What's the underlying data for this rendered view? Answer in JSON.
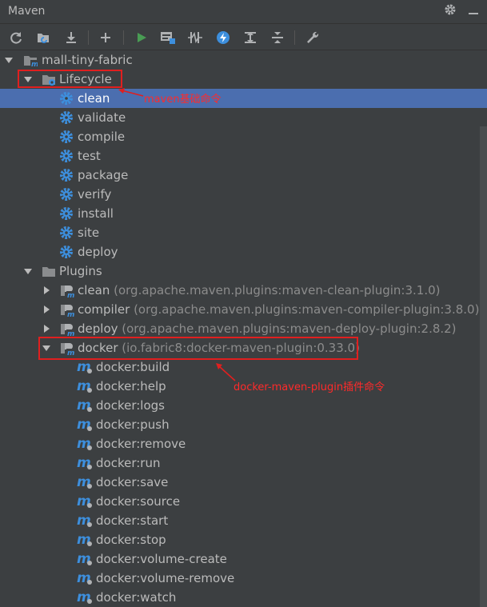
{
  "window": {
    "title": "Maven"
  },
  "toolbar": {
    "buttons": [
      {
        "name": "reimport-icon"
      },
      {
        "name": "generate-sources-icon"
      },
      {
        "name": "download-icon"
      },
      {
        "name": "add-icon"
      },
      {
        "name": "run-icon"
      },
      {
        "name": "execute-goal-icon"
      },
      {
        "name": "toggle-offline-icon"
      },
      {
        "name": "skip-tests-icon"
      },
      {
        "name": "show-dependencies-icon"
      },
      {
        "name": "collapse-all-icon"
      },
      {
        "name": "settings-wrench-icon"
      }
    ]
  },
  "tree": {
    "project": "mall-tiny-fabric",
    "lifecycle": {
      "label": "Lifecycle",
      "goals": [
        "clean",
        "validate",
        "compile",
        "test",
        "package",
        "verify",
        "install",
        "site",
        "deploy"
      ]
    },
    "plugins": {
      "label": "Plugins",
      "items": [
        {
          "name": "clean",
          "detail": "(org.apache.maven.plugins:maven-clean-plugin:3.1.0)"
        },
        {
          "name": "compiler",
          "detail": "(org.apache.maven.plugins:maven-compiler-plugin:3.8.0)"
        },
        {
          "name": "deploy",
          "detail": "(org.apache.maven.plugins:maven-deploy-plugin:2.8.2)"
        },
        {
          "name": "docker",
          "detail": "(io.fabric8:docker-maven-plugin:0.33.0)"
        }
      ],
      "docker_goals": [
        "docker:build",
        "docker:help",
        "docker:logs",
        "docker:push",
        "docker:remove",
        "docker:run",
        "docker:save",
        "docker:source",
        "docker:start",
        "docker:stop",
        "docker:volume-create",
        "docker:volume-remove",
        "docker:watch"
      ]
    }
  },
  "annotations": {
    "lifecycle_note": "maven基础命令",
    "docker_note": "docker-maven-plugin插件命令"
  },
  "colors": {
    "background": "#3c3f41",
    "selection": "#4b6eaf",
    "text": "#bbbbbb",
    "secondary_text": "#8c8c8c",
    "gear_blue": "#3d8fdd",
    "annotation_red": "#e01f1f"
  }
}
